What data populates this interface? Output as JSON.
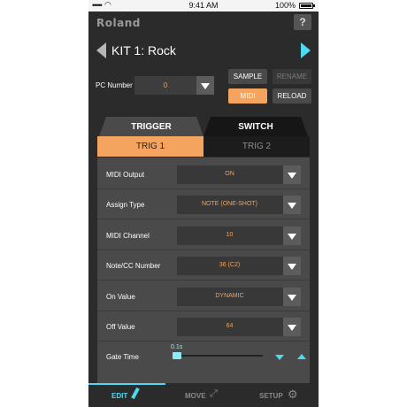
{
  "status_bar": {
    "carrier": "•••••",
    "time": "9:41 AM",
    "battery": "100%"
  },
  "header": {
    "logo": "Roland",
    "help_label": "?"
  },
  "kit": {
    "name": "KIT 1: Rock"
  },
  "pc": {
    "label": "PC Number",
    "value": "0"
  },
  "buttons": {
    "sample": "SAMPLE",
    "rename": "RENAME",
    "midi": "MIDI",
    "reload": "RELOAD"
  },
  "tabs": {
    "trigger": "TRIGGER",
    "switch": "SWITCH"
  },
  "subtabs": {
    "trig1": "TRIG 1",
    "trig2": "TRIG 2"
  },
  "params": [
    {
      "label": "MIDI Output",
      "value": "ON"
    },
    {
      "label": "Assign Type",
      "value": "NOTE (ONE-SHOT)"
    },
    {
      "label": "MIDI Channel",
      "value": "10"
    },
    {
      "label": "Note/CC Number",
      "value": "36 (C2)"
    },
    {
      "label": "On Value",
      "value": "DYNAMIC"
    },
    {
      "label": "Off Value",
      "value": "64"
    }
  ],
  "gate": {
    "label": "Gate Time",
    "value": "0.1s",
    "level_fraction": 0.1
  },
  "nav": {
    "edit": "EDIT",
    "move": "MOVE",
    "setup": "SETUP"
  },
  "colors": {
    "accent_orange": "#f5a45f",
    "accent_cyan": "#4ed9f0",
    "value_orange": "#f5a259"
  },
  "icons": {
    "help": "question-icon",
    "prev": "triangle-left-icon",
    "next": "triangle-right-icon",
    "dropdown": "triangle-down-icon",
    "edit": "pencil-icon",
    "move": "move-arrows-icon",
    "setup": "gear-icon"
  }
}
